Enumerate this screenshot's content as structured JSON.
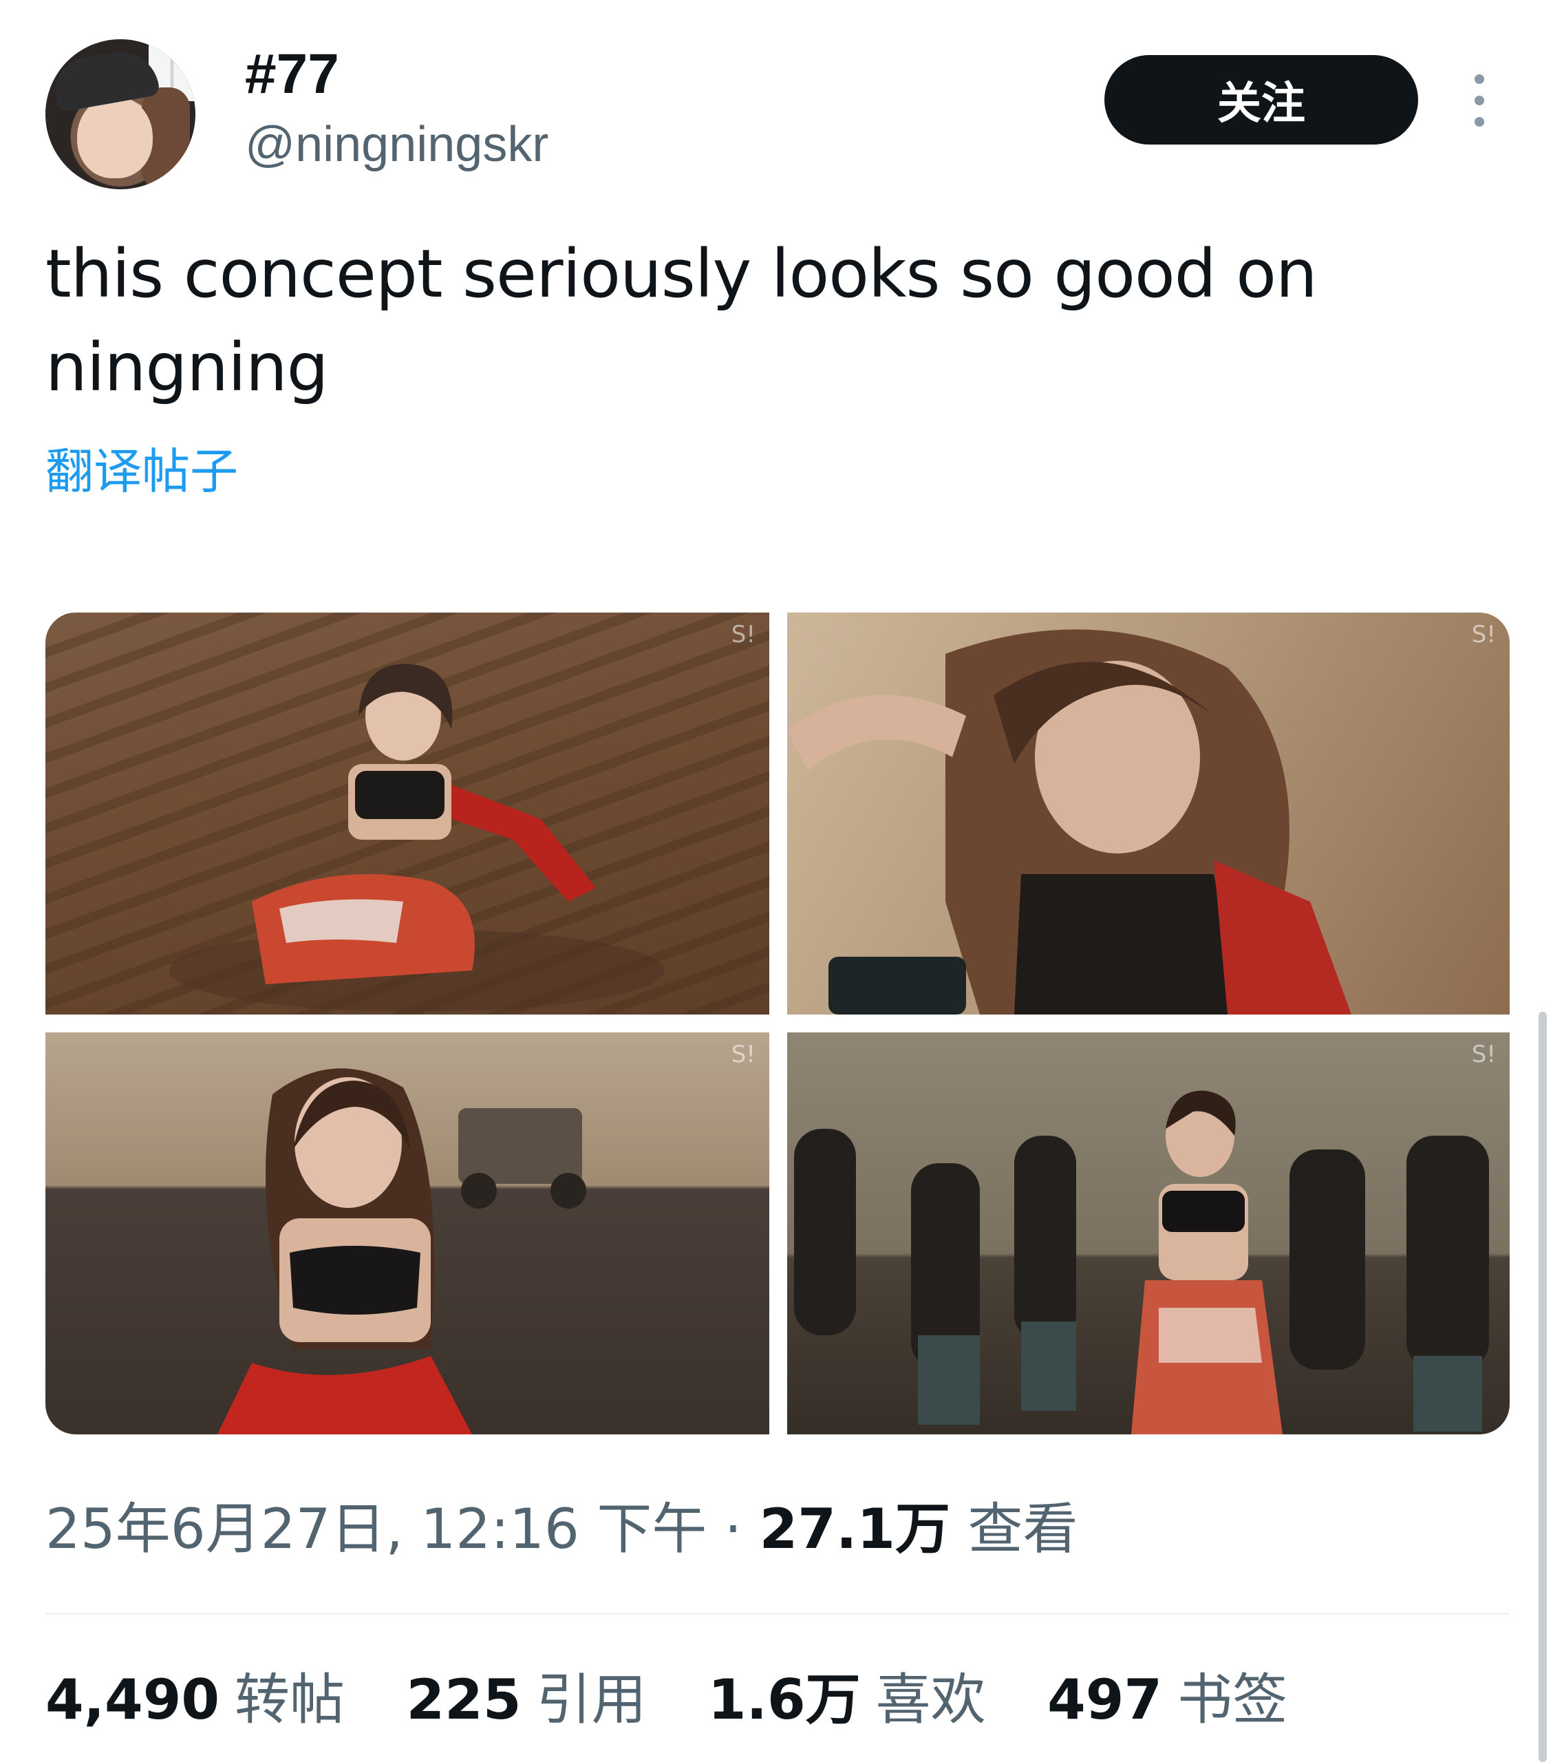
{
  "header": {
    "display_name": "#77",
    "handle": "@ningningskr",
    "follow_label": "关注"
  },
  "tweet": {
    "text": "this concept seriously looks so good on ningning",
    "translate_label": "翻译帖子"
  },
  "media": {
    "watermark": "S!"
  },
  "meta": {
    "date_time": "25年6月27日, 12:16 下午 · ",
    "views_count": "27.1万",
    "views_label": " 查看"
  },
  "stats": [
    {
      "count": "4,490",
      "label": "转帖"
    },
    {
      "count": "225",
      "label": "引用"
    },
    {
      "count": "1.6万",
      "label": "喜欢"
    },
    {
      "count": "497",
      "label": "书签"
    }
  ],
  "colors": {
    "text_primary": "#0f1419",
    "text_secondary": "#536471",
    "link": "#1d9bf0",
    "button_bg": "#0f1419"
  }
}
